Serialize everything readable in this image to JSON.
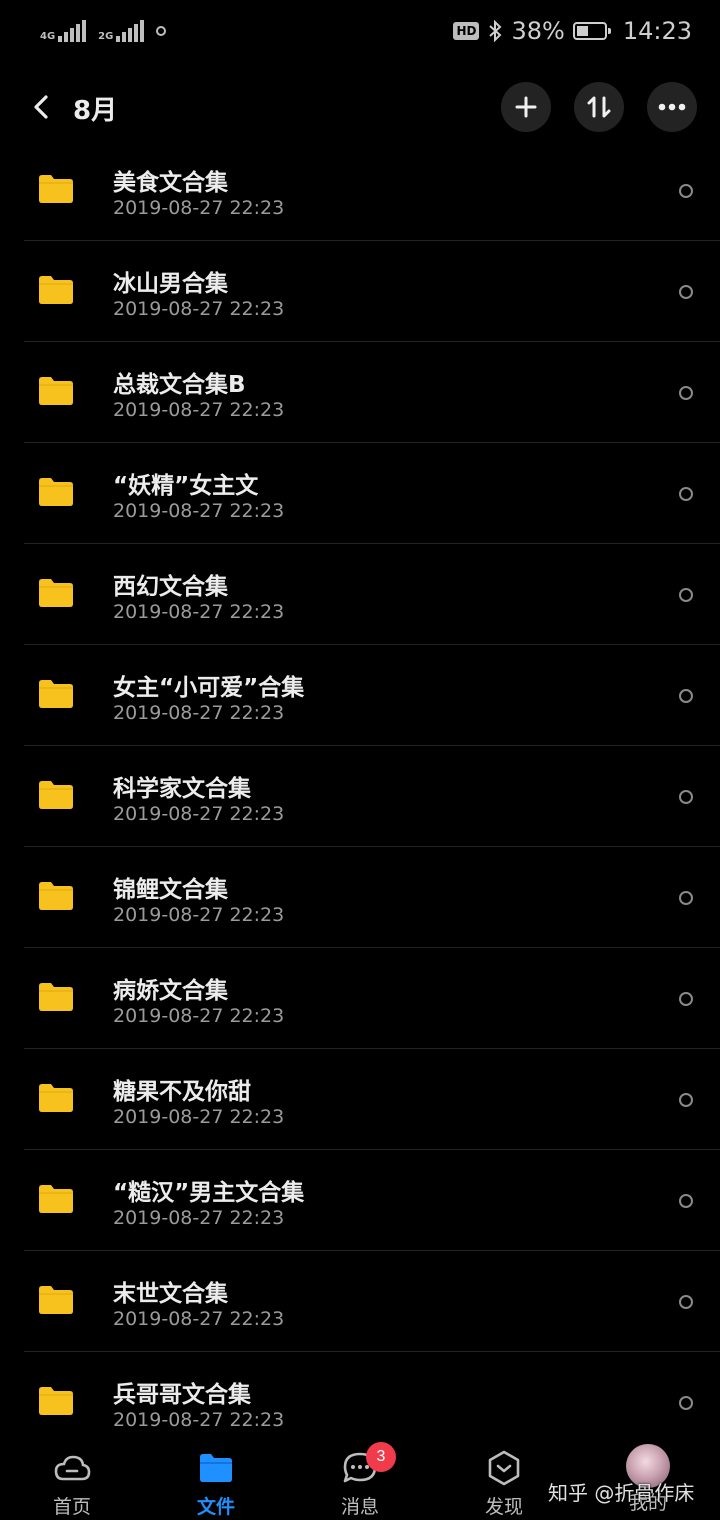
{
  "status_bar": {
    "net1": "4G",
    "net2": "2G",
    "hd": "HD",
    "battery": "38%",
    "time": "14:23"
  },
  "header": {
    "title": "8月"
  },
  "folders": [
    {
      "name": "美食文合集",
      "date": "2019-08-27  22:23"
    },
    {
      "name": "冰山男合集",
      "date": "2019-08-27  22:23"
    },
    {
      "name": "总裁文合集B",
      "date": "2019-08-27  22:23"
    },
    {
      "name": "“妖精”女主文",
      "date": "2019-08-27  22:23"
    },
    {
      "name": "西幻文合集",
      "date": "2019-08-27  22:23"
    },
    {
      "name": "女主“小可爱”合集",
      "date": "2019-08-27  22:23"
    },
    {
      "name": "科学家文合集",
      "date": "2019-08-27  22:23"
    },
    {
      "name": "锦鲤文合集",
      "date": "2019-08-27  22:23"
    },
    {
      "name": "病娇文合集",
      "date": "2019-08-27  22:23"
    },
    {
      "name": "糖果不及你甜",
      "date": "2019-08-27  22:23"
    },
    {
      "name": "“糙汉”男主文合集",
      "date": "2019-08-27  22:23"
    },
    {
      "name": "末世文合集",
      "date": "2019-08-27  22:23"
    },
    {
      "name": "兵哥哥文合集",
      "date": "2019-08-27  22:23"
    }
  ],
  "bottom_nav": {
    "items": [
      {
        "label": "首页",
        "icon": "cloud-icon"
      },
      {
        "label": "文件",
        "icon": "folder-icon"
      },
      {
        "label": "消息",
        "icon": "chat-icon",
        "badge": "3"
      },
      {
        "label": "发现",
        "icon": "discover-icon"
      },
      {
        "label": "我的",
        "icon": "avatar"
      }
    ],
    "active_index": 1
  },
  "watermark": "知乎 @折骨作床",
  "colors": {
    "background": "#000000",
    "folder": "#f7c21e",
    "accent": "#1e90ff",
    "badge": "#f03b4b"
  }
}
